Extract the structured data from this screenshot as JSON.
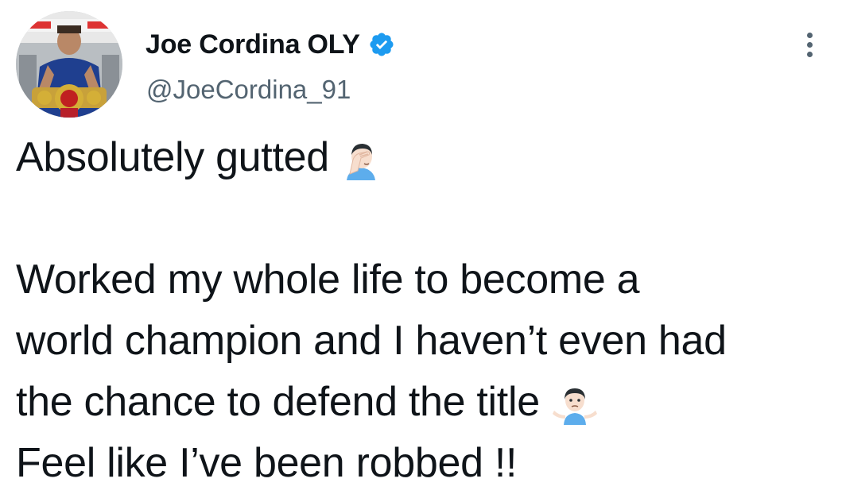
{
  "tweet": {
    "author": {
      "display_name": "Joe Cordina OLY",
      "handle": "@JoeCordina_91",
      "avatar_icon": "boxer-with-title-belts-avatar",
      "verified_icon": "verified-badge-icon",
      "verified_color": "#1d9bf0"
    },
    "more_icon": "more-options-icon",
    "body": {
      "line1": "Absolutely gutted",
      "line1_emoji": "face-palm-emoji",
      "line2": "Worked my whole life to become a",
      "line3": "world champion and I haven’t even had",
      "line4": "the chance to defend the title",
      "line4_emoji": "person-shrugging-emoji",
      "line5": "Feel like I’ve been robbed !!"
    }
  }
}
